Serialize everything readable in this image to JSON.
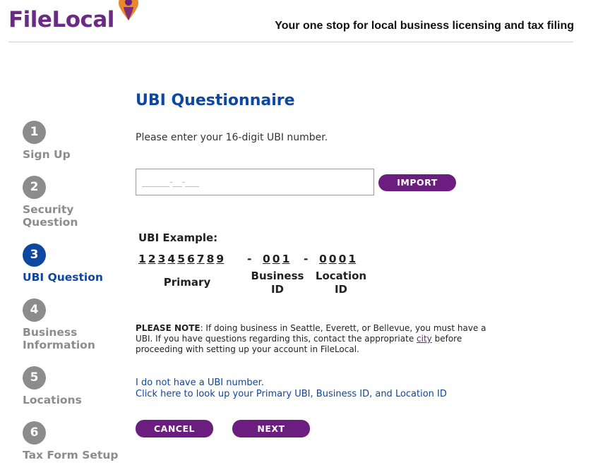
{
  "header": {
    "logo_text": "FileLocal",
    "tagline": "Your one stop for local business licensing and tax filing"
  },
  "steps": [
    {
      "number": "1",
      "label": "Sign Up",
      "active": false
    },
    {
      "number": "2",
      "label": "Security Question",
      "active": false
    },
    {
      "number": "3",
      "label": "UBI Question",
      "active": true
    },
    {
      "number": "4",
      "label": "Business Information",
      "active": false
    },
    {
      "number": "5",
      "label": "Locations",
      "active": false
    },
    {
      "number": "6",
      "label": "Tax Form Setup",
      "active": false
    }
  ],
  "main": {
    "title": "UBI Questionnaire",
    "instruction": "Please enter your 16-digit UBI number.",
    "ubi_input": {
      "value": "",
      "placeholder": "______-__-___"
    },
    "import_label": "IMPORT",
    "example": {
      "heading": "UBI Example:",
      "primary_digits": [
        "1",
        "2",
        "3",
        "4",
        "5",
        "6",
        "7",
        "8",
        "9"
      ],
      "business_digits": [
        "0",
        "0",
        "1"
      ],
      "location_digits": [
        "0",
        "0",
        "0",
        "1"
      ],
      "separator": "-",
      "primary_label": "Primary",
      "business_label": "Business ID",
      "location_label": "Location ID"
    },
    "note": {
      "prefix": "PLEASE NOTE",
      "text_before_link": ": If doing business in Seattle, Everett, or Bellevue, you must have a UBI. If you have questions regarding this, contact the appropriate ",
      "link_text": "city",
      "text_after_link": " before proceeding with setting up your account in FileLocal."
    },
    "no_ubi_link": "I do not have a UBI number.",
    "lookup_link": "Click here to look up your Primary UBI, Business ID, and Location ID",
    "cancel_label": "CANCEL",
    "next_label": "NEXT"
  },
  "colors": {
    "brand_purple": "#6b1e7f",
    "active_blue": "#0d47a1",
    "inactive_gray": "#8c8c8c",
    "pin_orange": "#f5a623"
  }
}
